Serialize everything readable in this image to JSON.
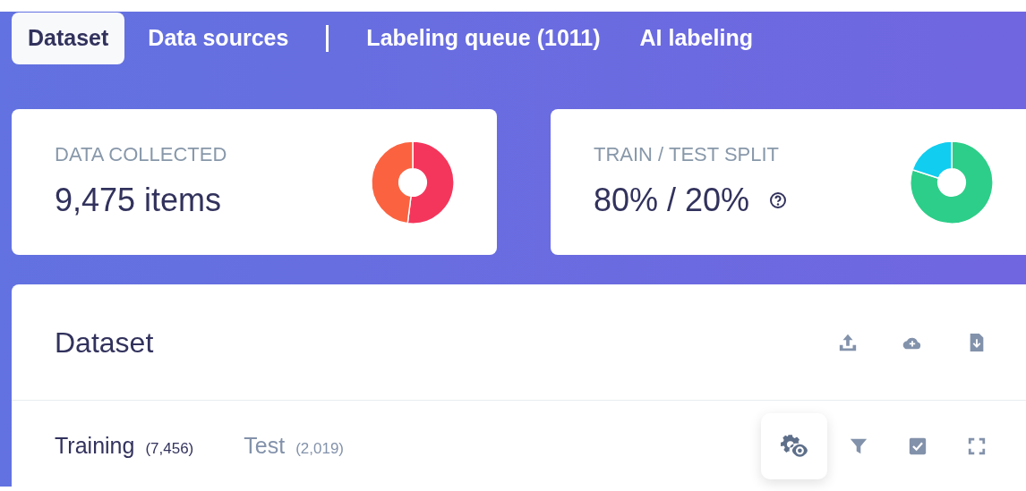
{
  "tabs": [
    {
      "label": "Dataset",
      "selected": true
    },
    {
      "label": "Data sources",
      "selected": false,
      "divider_after": true
    },
    {
      "label": "Labeling queue (1011)",
      "selected": false
    },
    {
      "label": "AI labeling",
      "selected": false
    }
  ],
  "stats": [
    {
      "label": "DATA COLLECTED",
      "value": "9,475 items",
      "help": false,
      "kind": "collected"
    },
    {
      "label": "TRAIN / TEST SPLIT",
      "value": "80% / 20%",
      "help": true,
      "kind": "split"
    }
  ],
  "panel": {
    "title": "Dataset",
    "subtabs": [
      {
        "label": "Training",
        "count": "(7,456)",
        "selected": true
      },
      {
        "label": "Test",
        "count": "(2,019)",
        "selected": false
      }
    ]
  }
}
